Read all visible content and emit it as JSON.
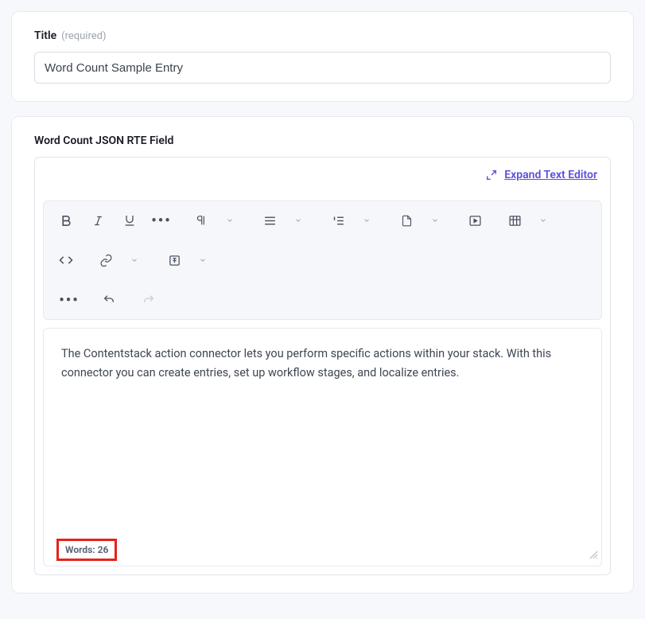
{
  "title_field": {
    "label": "Title",
    "hint": "(required)",
    "value": "Word Count Sample Entry"
  },
  "rte_field": {
    "label": "Word Count JSON RTE Field",
    "expand_label": "Expand Text Editor",
    "content": "The Contentstack action connector lets you perform specific actions within your stack. With this connector you can create entries, set up workflow stages, and localize entries.",
    "word_count_label": "Words: 26"
  }
}
